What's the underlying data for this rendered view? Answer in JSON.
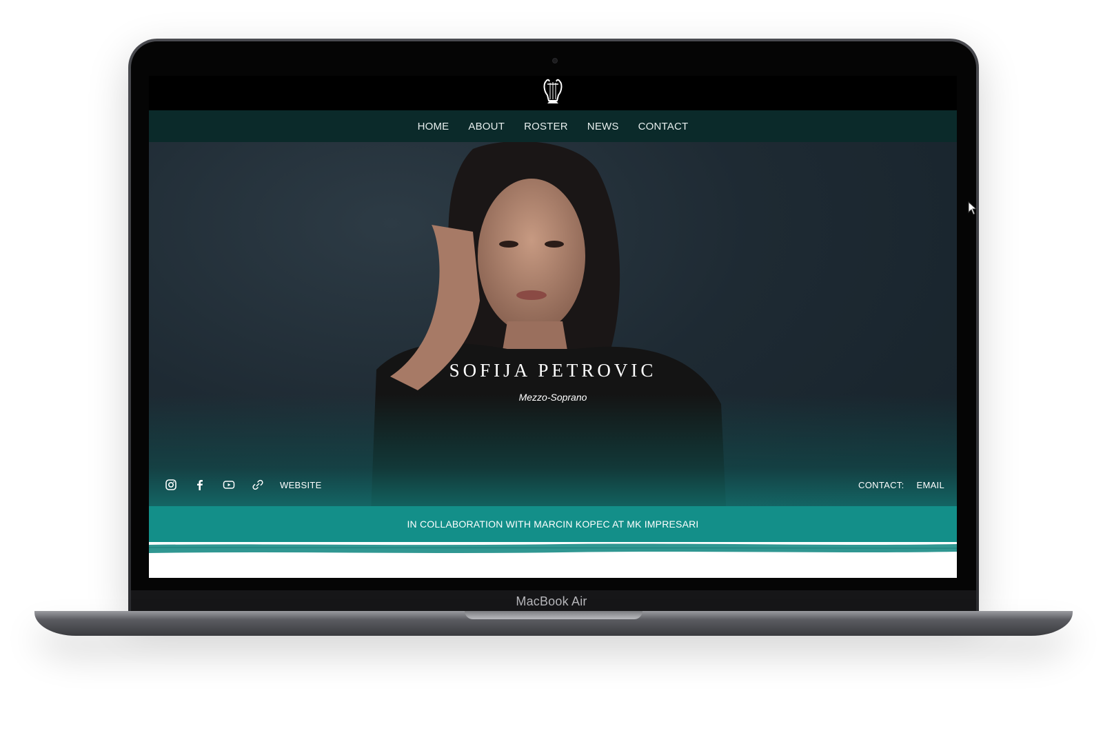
{
  "device": {
    "label": "MacBook Air"
  },
  "site": {
    "logo_icon": "lyre-icon",
    "nav": [
      {
        "label": "HOME"
      },
      {
        "label": "ABOUT"
      },
      {
        "label": "ROSTER"
      },
      {
        "label": "NEWS"
      },
      {
        "label": "CONTACT"
      }
    ]
  },
  "hero": {
    "title": "SOFIJA PETROVIC",
    "subtitle": "Mezzo-Soprano"
  },
  "social": {
    "icons": [
      "instagram-icon",
      "facebook-icon",
      "youtube-icon",
      "link-icon"
    ],
    "website_label": "WEBSITE"
  },
  "contact": {
    "label": "CONTACT:",
    "email_label": "EMAIL"
  },
  "collaboration": {
    "text": "IN COLLABORATION WITH MARCIN KOPEC AT MK IMPRESARI"
  },
  "colors": {
    "nav_bg": "#0b2a2a",
    "accent_teal": "#138f89",
    "hero_bg": "#1e2a33"
  }
}
